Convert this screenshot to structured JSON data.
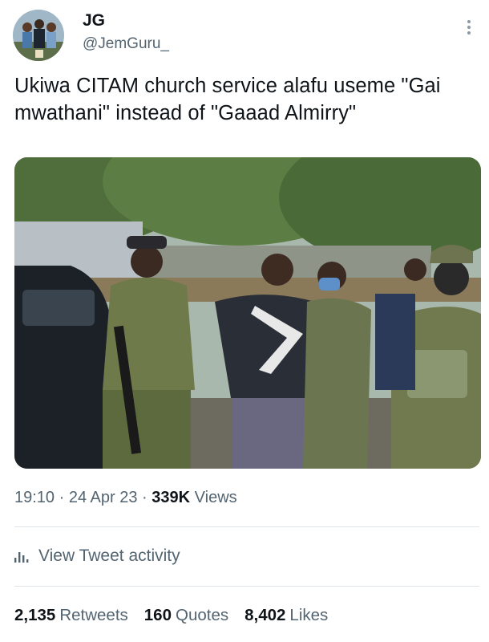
{
  "author": {
    "display_name": "JG",
    "handle": "@JemGuru_",
    "avatar_icon": "profile-photo"
  },
  "more_icon": "three-dots-vertical-icon",
  "tweet": {
    "text": "Ukiwa CITAM church service alafu useme \"Gai mwathani\" instead of \"Gaaad Almirry\""
  },
  "meta": {
    "time": "19:10",
    "separator": "·",
    "date": "24 Apr 23",
    "views_count": "339K",
    "views_label": "Views"
  },
  "activity": {
    "icon": "bar-chart-icon",
    "label": "View Tweet activity"
  },
  "stats": [
    {
      "count": "2,135",
      "label": "Retweets"
    },
    {
      "count": "160",
      "label": "Quotes"
    },
    {
      "count": "8,402",
      "label": "Likes"
    }
  ]
}
